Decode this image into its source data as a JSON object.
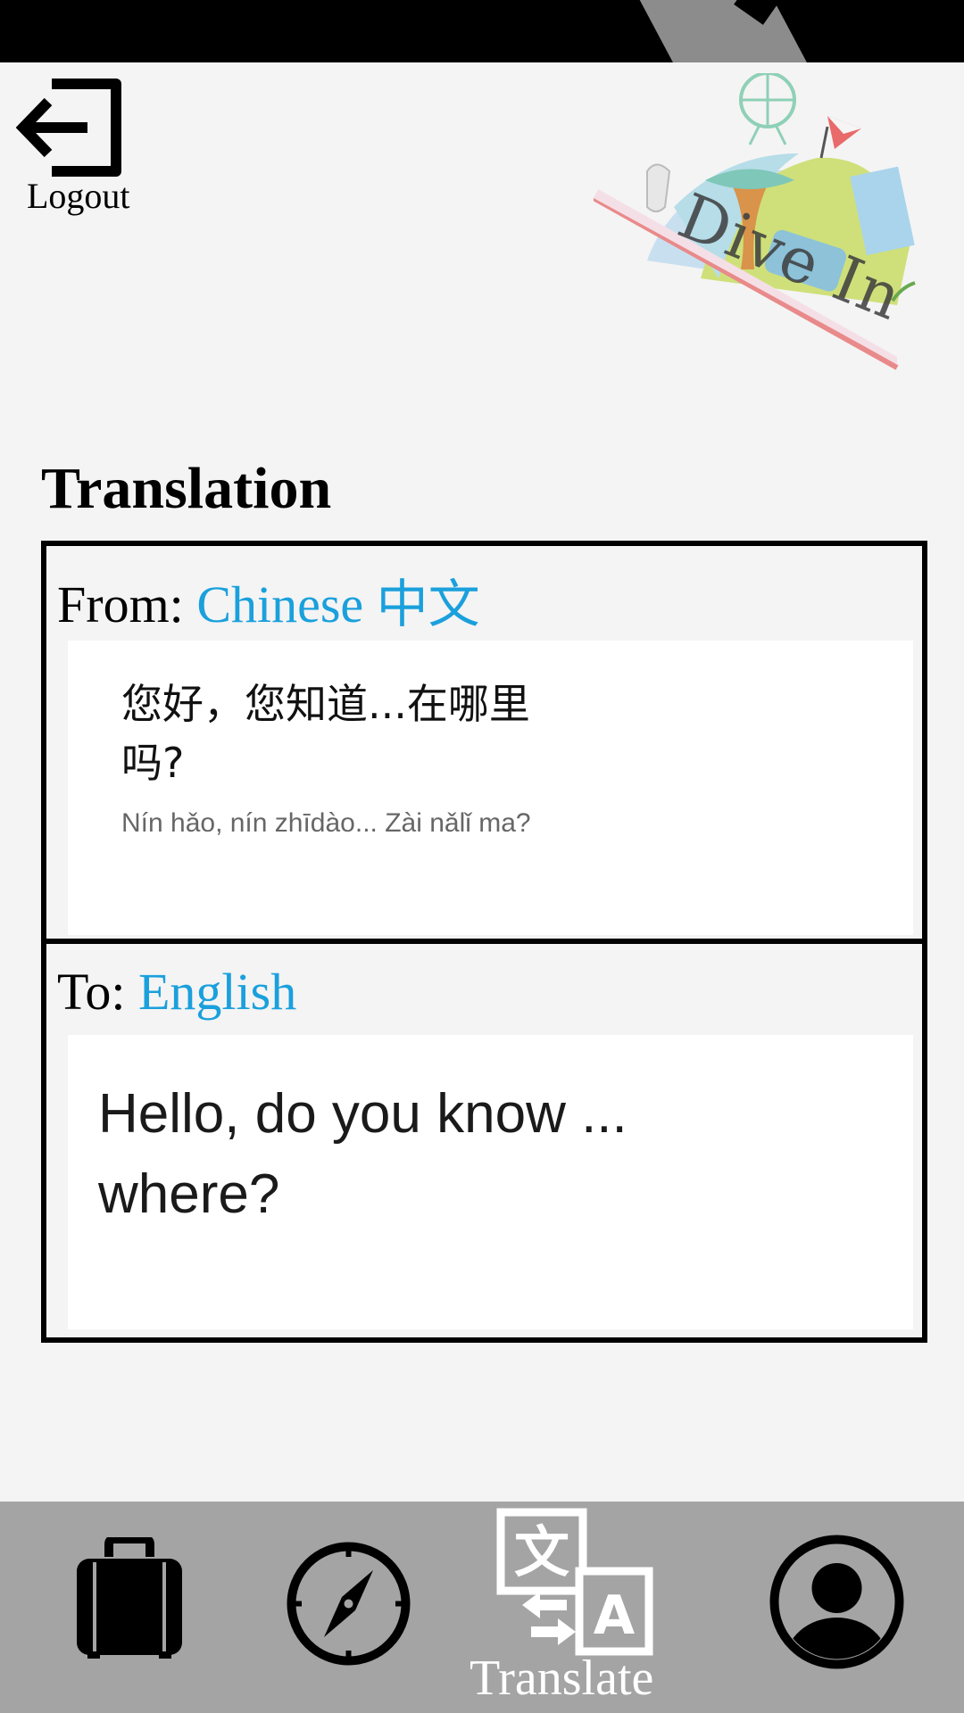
{
  "header": {
    "logout_label": "Logout",
    "logo_text": "Dive In"
  },
  "page": {
    "title": "Translation"
  },
  "translation": {
    "from_prefix": "From:",
    "from_language": "Chinese 中文",
    "source_text": "您好，您知道...在哪里吗?",
    "source_romanized": "Nín hǎo, nín zhīdào... Zài nǎlǐ ma?",
    "to_prefix": "To:",
    "to_language": "English",
    "target_text": "Hello, do you know ... where?"
  },
  "nav": {
    "items": [
      {
        "name": "baggage",
        "icon": "briefcase-icon"
      },
      {
        "name": "explore",
        "icon": "compass-icon"
      },
      {
        "name": "translate",
        "icon": "translate-icon",
        "label": "Translate",
        "active": true
      },
      {
        "name": "profile",
        "icon": "user-icon"
      }
    ]
  },
  "colors": {
    "accent": "#1aa0dc",
    "nav_background": "#a4a4a4",
    "page_background": "#f4f4f4"
  }
}
